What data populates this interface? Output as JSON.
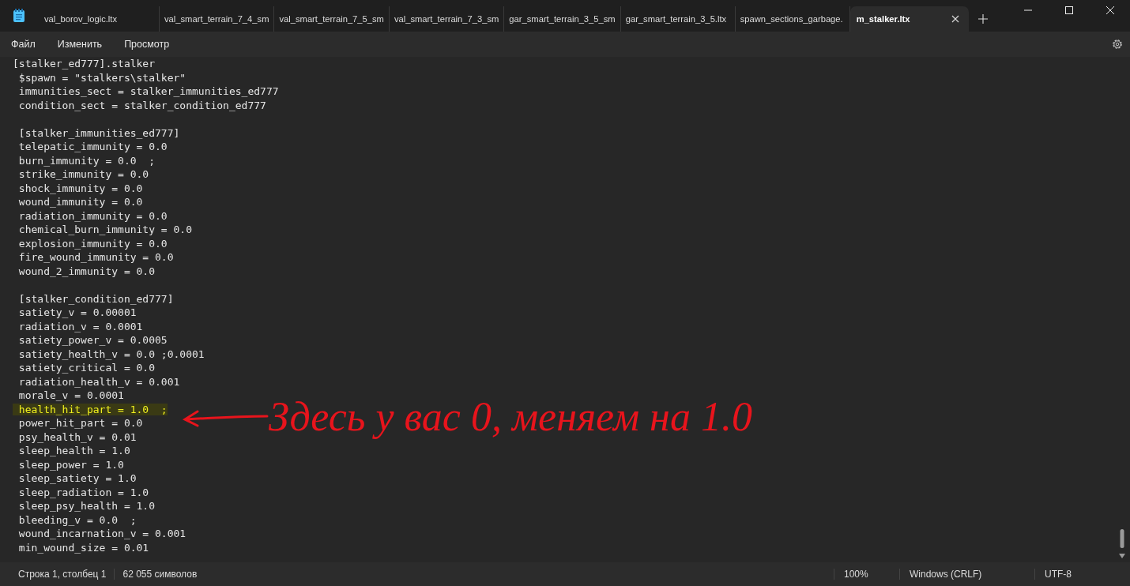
{
  "tabs": [
    {
      "label": "val_borov_logic.ltx",
      "selected": false
    },
    {
      "label": "val_smart_terrain_7_4_sm",
      "selected": false
    },
    {
      "label": "val_smart_terrain_7_5_sm",
      "selected": false
    },
    {
      "label": "val_smart_terrain_7_3_sm",
      "selected": false
    },
    {
      "label": "gar_smart_terrain_3_5_sm",
      "selected": false
    },
    {
      "label": "gar_smart_terrain_3_5.ltx",
      "selected": false
    },
    {
      "label": "spawn_sections_garbage.",
      "selected": false
    },
    {
      "label": "m_stalker.ltx",
      "selected": true
    }
  ],
  "menu": [
    "Файл",
    "Изменить",
    "Просмотр"
  ],
  "sections": [
    {
      "lines": [
        {
          "text": "[stalker_ed777].stalker",
          "highlighted": false
        },
        {
          "text": " $spawn = \"stalkers\\stalker\"",
          "highlighted": false
        },
        {
          "text": " immunities_sect = stalker_immunities_ed777",
          "highlighted": false
        },
        {
          "text": " condition_sect = stalker_condition_ed777",
          "highlighted": false
        }
      ]
    },
    {
      "lines": [
        {
          "text": " [stalker_immunities_ed777]",
          "highlighted": false
        },
        {
          "text": " telepatic_immunity = 0.0",
          "highlighted": false
        },
        {
          "text": " burn_immunity = 0.0  ;",
          "highlighted": false
        },
        {
          "text": " strike_immunity = 0.0",
          "highlighted": false
        },
        {
          "text": " shock_immunity = 0.0",
          "highlighted": false
        },
        {
          "text": " wound_immunity = 0.0",
          "highlighted": false
        },
        {
          "text": " radiation_immunity = 0.0",
          "highlighted": false
        },
        {
          "text": " chemical_burn_immunity = 0.0",
          "highlighted": false
        },
        {
          "text": " explosion_immunity = 0.0",
          "highlighted": false
        },
        {
          "text": " fire_wound_immunity = 0.0",
          "highlighted": false
        },
        {
          "text": " wound_2_immunity = 0.0",
          "highlighted": false
        }
      ]
    },
    {
      "lines": [
        {
          "text": " [stalker_condition_ed777]",
          "highlighted": false
        },
        {
          "text": " satiety_v = 0.00001",
          "highlighted": false
        },
        {
          "text": " radiation_v = 0.0001",
          "highlighted": false
        },
        {
          "text": " satiety_power_v = 0.0005",
          "highlighted": false
        },
        {
          "text": " satiety_health_v = 0.0 ;0.0001",
          "highlighted": false
        },
        {
          "text": " satiety_critical = 0.0",
          "highlighted": false
        },
        {
          "text": " radiation_health_v = 0.001",
          "highlighted": false
        },
        {
          "text": " morale_v = 0.0001",
          "highlighted": false
        },
        {
          "text": " health_hit_part = 1.0  ;",
          "highlighted": true
        },
        {
          "text": " power_hit_part = 0.0",
          "highlighted": false
        },
        {
          "text": " psy_health_v = 0.01",
          "highlighted": false
        },
        {
          "text": " sleep_health = 1.0",
          "highlighted": false
        },
        {
          "text": " sleep_power = 1.0",
          "highlighted": false
        },
        {
          "text": " sleep_satiety = 1.0",
          "highlighted": false
        },
        {
          "text": " sleep_radiation = 1.0",
          "highlighted": false
        },
        {
          "text": " sleep_psy_health = 1.0",
          "highlighted": false
        },
        {
          "text": " bleeding_v = 0.0  ;",
          "highlighted": false
        },
        {
          "text": " wound_incarnation_v = 0.001",
          "highlighted": false
        },
        {
          "text": " min_wound_size = 0.01",
          "highlighted": false
        }
      ]
    }
  ],
  "annotation": {
    "text": "Здесь у вас 0, меняем на 1.0",
    "color": "#e8141c"
  },
  "status_bar": {
    "position": "Строка 1, столбец 1",
    "characters": "62 055 символов",
    "zoom": "100%",
    "line_ending": "Windows (CRLF)",
    "encoding": "UTF-8"
  }
}
